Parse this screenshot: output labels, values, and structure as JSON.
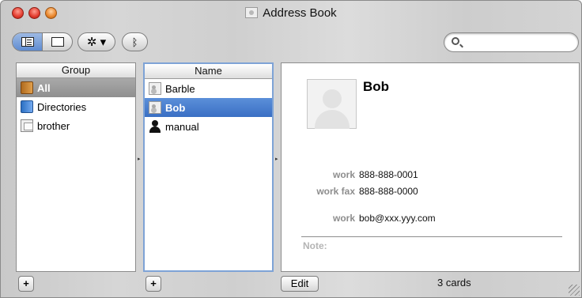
{
  "window": {
    "title": "Address Book"
  },
  "group_column": {
    "header": "Group",
    "items": [
      {
        "label": "All",
        "icon": "address-book-icon",
        "selected": true
      },
      {
        "label": "Directories",
        "icon": "directory-icon",
        "selected": false
      },
      {
        "label": "brother",
        "icon": "group-icon",
        "selected": false
      }
    ]
  },
  "name_column": {
    "header": "Name",
    "items": [
      {
        "label": "Barble",
        "icon": "card-icon",
        "selected": false
      },
      {
        "label": "Bob",
        "icon": "card-icon",
        "selected": true
      },
      {
        "label": "manual",
        "icon": "person-icon",
        "selected": false
      }
    ]
  },
  "card": {
    "name": "Bob",
    "fields": [
      {
        "label": "work",
        "value": "888-888-0001"
      },
      {
        "label": "work fax",
        "value": "888-888-0000"
      },
      {
        "label": "work",
        "value": "bob@xxx.yyy.com"
      }
    ],
    "note_label": "Note:"
  },
  "bottom_bar": {
    "add_group": "+",
    "add_card": "+",
    "edit_label": "Edit",
    "card_count": "3 cards"
  },
  "toolbar": {
    "gear_symbol": "✲ ▾",
    "bluetooth_symbol": "ᛒ"
  }
}
